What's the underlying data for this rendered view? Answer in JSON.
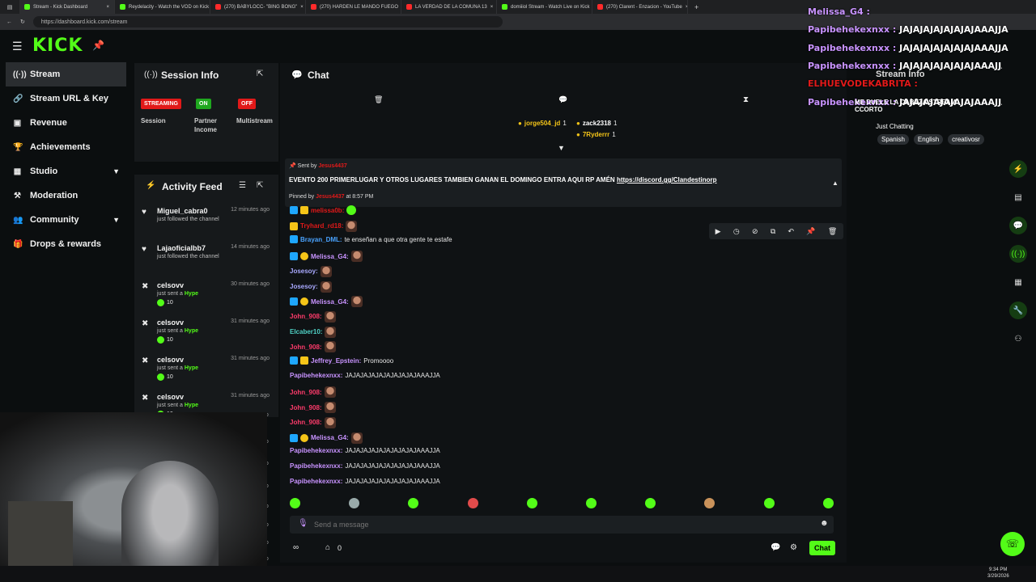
{
  "browser": {
    "tabs": [
      {
        "title": "Stream - Kick Dashboard",
        "color": "#53fc18"
      },
      {
        "title": "Reydelacity - Watch the VOD on Kick",
        "color": "#53fc18"
      },
      {
        "title": "(270) BABYLOCC- \"BING BONG\"",
        "color": "#ff2a2a"
      },
      {
        "title": "(270) HARDEN LE MANDO FUEGO",
        "color": "#ff2a2a"
      },
      {
        "title": "LA VERDAD DE LA COMUNA 13",
        "color": "#ff2a2a"
      },
      {
        "title": "domiiiol Stream - Watch Live on Kick",
        "color": "#53fc18"
      },
      {
        "title": "(270) Clarent - Enzacion - YouTube",
        "color": "#ff2a2a"
      }
    ],
    "url": "https://dashboard.kick.com/stream"
  },
  "logo": "KICK",
  "sidebar": {
    "items": [
      {
        "label": "Stream",
        "icon": "broadcast-icon",
        "glyph": "((·))"
      },
      {
        "label": "Stream URL & Key",
        "icon": "link-icon",
        "glyph": "🔗"
      },
      {
        "label": "Revenue",
        "icon": "bank-icon",
        "glyph": "▣"
      },
      {
        "label": "Achievements",
        "icon": "trophy-icon",
        "glyph": "🏆"
      },
      {
        "label": "Studio",
        "icon": "studio-icon",
        "glyph": "▦"
      },
      {
        "label": "Moderation",
        "icon": "gavel-icon",
        "glyph": "⚒"
      },
      {
        "label": "Community",
        "icon": "community-icon",
        "glyph": "👥"
      },
      {
        "label": "Drops & rewards",
        "icon": "gift-icon",
        "glyph": "🎁"
      }
    ]
  },
  "session": {
    "title": "Session Info",
    "status": [
      {
        "badge": "STREAMING",
        "label": "Session",
        "color": "#e11919"
      },
      {
        "badge": "ON",
        "label": "Partner Income",
        "color": "#1fa81f"
      },
      {
        "badge": "OFF",
        "label": "Multistream",
        "color": "#e11919"
      }
    ]
  },
  "activity": {
    "title": "Activity Feed",
    "items": [
      {
        "name": "Miguel_cabra0",
        "action": "just followed the channel",
        "time": "12 minutes ago",
        "icon": "heart-icon",
        "amount": ""
      },
      {
        "name": "Lajaoficialbb7",
        "action": "just followed the channel",
        "time": "14 minutes ago",
        "icon": "heart-icon",
        "amount": ""
      },
      {
        "name": "celsovv",
        "action": "just sent a",
        "highlight": "Hype",
        "time": "30 minutes ago",
        "icon": "kick-icon",
        "amount": "10"
      },
      {
        "name": "celsovv",
        "action": "just sent a",
        "highlight": "Hype",
        "time": "31 minutes ago",
        "icon": "kick-icon",
        "amount": "10"
      },
      {
        "name": "celsovv",
        "action": "just sent a",
        "highlight": "Hype",
        "time": "31 minutes ago",
        "icon": "kick-icon",
        "amount": "10"
      },
      {
        "name": "celsovv",
        "action": "just sent a",
        "highlight": "Hype",
        "time": "31 minutes ago",
        "icon": "kick-icon",
        "amount": "10"
      }
    ],
    "partial_times": [
      "go",
      "go",
      "go",
      "go",
      "go",
      "go",
      "go",
      "go"
    ]
  },
  "chat": {
    "title": "Chat",
    "top_gifters": [
      {
        "name": "jorge504_jd",
        "count": "1"
      },
      {
        "name": "zack2318",
        "count": "1"
      },
      {
        "name": "7Ryderrr",
        "count": "1"
      }
    ],
    "pinned": {
      "sent_by_label": "Sent by",
      "sent_by_user": "Jesus4437",
      "text": "EVENTO 200 PRIMERLUGAR Y OTROS LUGARES TAMBIEN GANAN EL DOMINGO ENTRA AQUI RP AMÉN",
      "link": "https://discord.gg/Clandestinorp",
      "pinned_by_label": "Pinned by",
      "pinned_by_user": "Jesus4437",
      "pinned_time": "at 8:57 PM"
    },
    "messages": [
      {
        "user": "melissa0b:",
        "color": "#e11919",
        "text": "",
        "emote": "green"
      },
      {
        "user": "Tryhard_rd18:",
        "color": "#e11919",
        "text": "",
        "emote": "face"
      },
      {
        "user": "Brayan_DML:",
        "color": "#4aa3ff",
        "text": "te enseñan a que otra gente te estafe",
        "emote": ""
      },
      {
        "user": "Melissa_G4:",
        "color": "#c893ff",
        "text": "",
        "emote": "face"
      },
      {
        "user": "Josesoy:",
        "color": "#a9a9ff",
        "text": "",
        "emote": "face"
      },
      {
        "user": "Josesoy:",
        "color": "#a9a9ff",
        "text": "",
        "emote": "face"
      },
      {
        "user": "Melissa_G4:",
        "color": "#c893ff",
        "text": "",
        "emote": "face"
      },
      {
        "user": "John_908:",
        "color": "#ff3b6b",
        "text": "",
        "emote": "face"
      },
      {
        "user": "Elcaber10:",
        "color": "#4fd1c5",
        "text": "",
        "emote": "face"
      },
      {
        "user": "John_908:",
        "color": "#ff3b6b",
        "text": "",
        "emote": "face"
      },
      {
        "user": "Jeffrey_Epstein:",
        "color": "#c893ff",
        "text": "Promoooo",
        "emote": ""
      },
      {
        "user": "Papibehekexnxx:",
        "color": "#c893ff",
        "text": "JAJAJAJAJAJAJAJAJAJAAAJJA",
        "emote": ""
      },
      {
        "user": "John_908:",
        "color": "#ff3b6b",
        "text": "",
        "emote": "face"
      },
      {
        "user": "John_908:",
        "color": "#ff3b6b",
        "text": "",
        "emote": "face"
      },
      {
        "user": "John_908:",
        "color": "#ff3b6b",
        "text": "",
        "emote": "face"
      },
      {
        "user": "Melissa_G4:",
        "color": "#c893ff",
        "text": "",
        "emote": "face"
      },
      {
        "user": "Papibehekexnxx:",
        "color": "#c893ff",
        "text": "JAJAJAJAJAJAJAJAJAJAAAJJA",
        "emote": ""
      },
      {
        "user": "Papibehekexnxx:",
        "color": "#c893ff",
        "text": "JAJAJAJAJAJAJAJAJAJAAAJJA",
        "emote": ""
      },
      {
        "user": "Papibehekexnxx:",
        "color": "#c893ff",
        "text": "JAJAJAJAJAJAJAJAJAJAAAJJA",
        "emote": ""
      }
    ],
    "input_placeholder": "Send a message",
    "points": "0",
    "send_label": "Chat"
  },
  "overlay": {
    "lines": [
      {
        "user": "Melissa_G4",
        "text": ""
      },
      {
        "user": "Papibehekexnxx",
        "text": "JAJAJAJAJAJAJAJAAAJJA"
      },
      {
        "user": "Papibehekexnxx",
        "text": "JAJAJAJAJAJAJAJAAAJJA"
      },
      {
        "user": "Papibehekexnxx",
        "text": "JAJAJAJAJAJAJAJAAAJJA"
      },
      {
        "user": "ELHUEVODEKABRITA",
        "text": ""
      },
      {
        "user": "Papibehekexnxx",
        "text": "JAJAJAJAJAJAJAJAAAJJA"
      }
    ],
    "stream_info_title": "Stream Info",
    "stream_title": "ME DUELE LA CABEZA STREAM CCORTO",
    "category": "Just Chatting",
    "tags": [
      "Spanish",
      "English",
      "creativosr"
    ]
  },
  "clock": {
    "time": "9:34 PM",
    "date": "3/29/2026"
  }
}
